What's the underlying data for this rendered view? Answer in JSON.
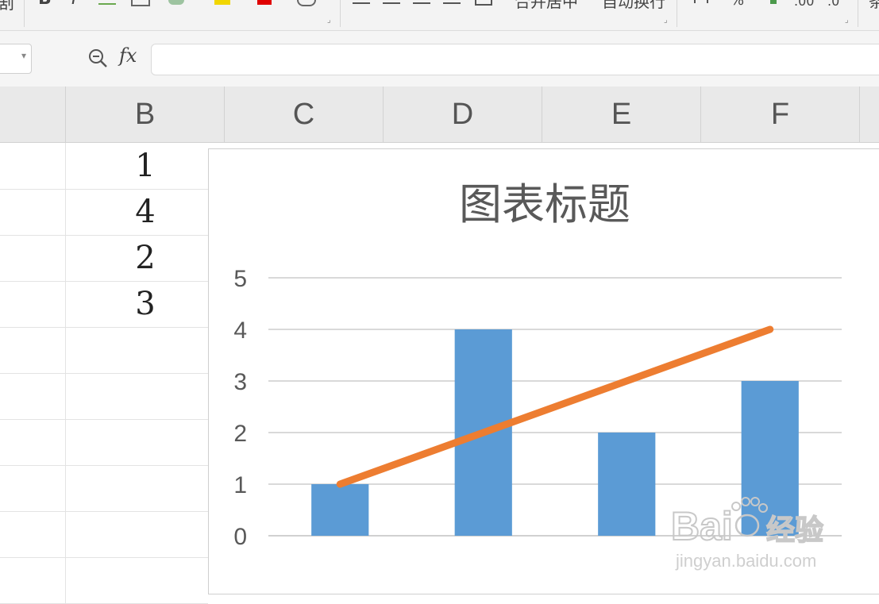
{
  "toolbar": {
    "partial_left": "剧",
    "bold": "B",
    "italic": "I",
    "merge_center": "合并居中",
    "auto_wrap": "自动换行",
    "percent": "%",
    "decimal_add": ".00",
    "decimal_remove": ".0",
    "partial_right": "条"
  },
  "formula_bar": {
    "fx_label": "fx",
    "value": ""
  },
  "columns": [
    "B",
    "C",
    "D",
    "E",
    "F"
  ],
  "rows": [
    {
      "a": "",
      "b": "1"
    },
    {
      "a": "",
      "b": "4"
    },
    {
      "a": "",
      "b": "2"
    },
    {
      "a": "",
      "b": "3"
    },
    {
      "a": "",
      "b": ""
    },
    {
      "a": "",
      "b": ""
    },
    {
      "a": "",
      "b": ""
    },
    {
      "a": "",
      "b": ""
    },
    {
      "a": "",
      "b": ""
    },
    {
      "a": "",
      "b": ""
    }
  ],
  "chart_data": {
    "type": "bar",
    "title": "图表标题",
    "categories": [
      "",
      "",
      "",
      ""
    ],
    "series": [
      {
        "type": "bar",
        "values": [
          1,
          4,
          2,
          3
        ],
        "color": "#5b9bd5"
      },
      {
        "type": "line",
        "values": [
          1,
          2,
          3,
          4
        ],
        "color": "#ed7d31"
      }
    ],
    "yticks": [
      "0",
      "1",
      "2",
      "3",
      "4",
      "5"
    ],
    "ylim": [
      0,
      5
    ],
    "grid": true
  },
  "watermark": {
    "brand": "Bai",
    "brand_cn": "经验",
    "url": "jingyan.baidu.com",
    "color": "#c8c8c8"
  }
}
